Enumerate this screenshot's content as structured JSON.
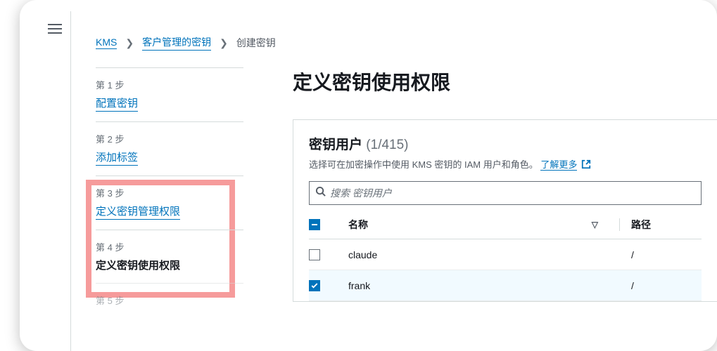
{
  "breadcrumb": {
    "root": "KMS",
    "mid": "客户管理的密钥",
    "current": "创建密钥"
  },
  "steps": [
    {
      "label": "第 1 步",
      "title": "配置密钥",
      "active": false
    },
    {
      "label": "第 2 步",
      "title": "添加标签",
      "active": false
    },
    {
      "label": "第 3 步",
      "title": "定义密钥管理权限",
      "active": false
    },
    {
      "label": "第 4 步",
      "title": "定义密钥使用权限",
      "active": true
    },
    {
      "label": "第 5 步",
      "title": "",
      "active": false
    }
  ],
  "page": {
    "title": "定义密钥使用权限"
  },
  "panel": {
    "title": "密钥用户",
    "count": "(1/415)",
    "description": "选择可在加密操作中使用 KMS 密钥的 IAM 用户和角色。",
    "learn_more": "了解更多",
    "search_placeholder": "搜索 密钥用户"
  },
  "table": {
    "columns": {
      "name": "名称",
      "path": "路径"
    },
    "rows": [
      {
        "name": "claude",
        "path": "/",
        "checked": false
      },
      {
        "name": "frank",
        "path": "/",
        "checked": true
      }
    ]
  }
}
